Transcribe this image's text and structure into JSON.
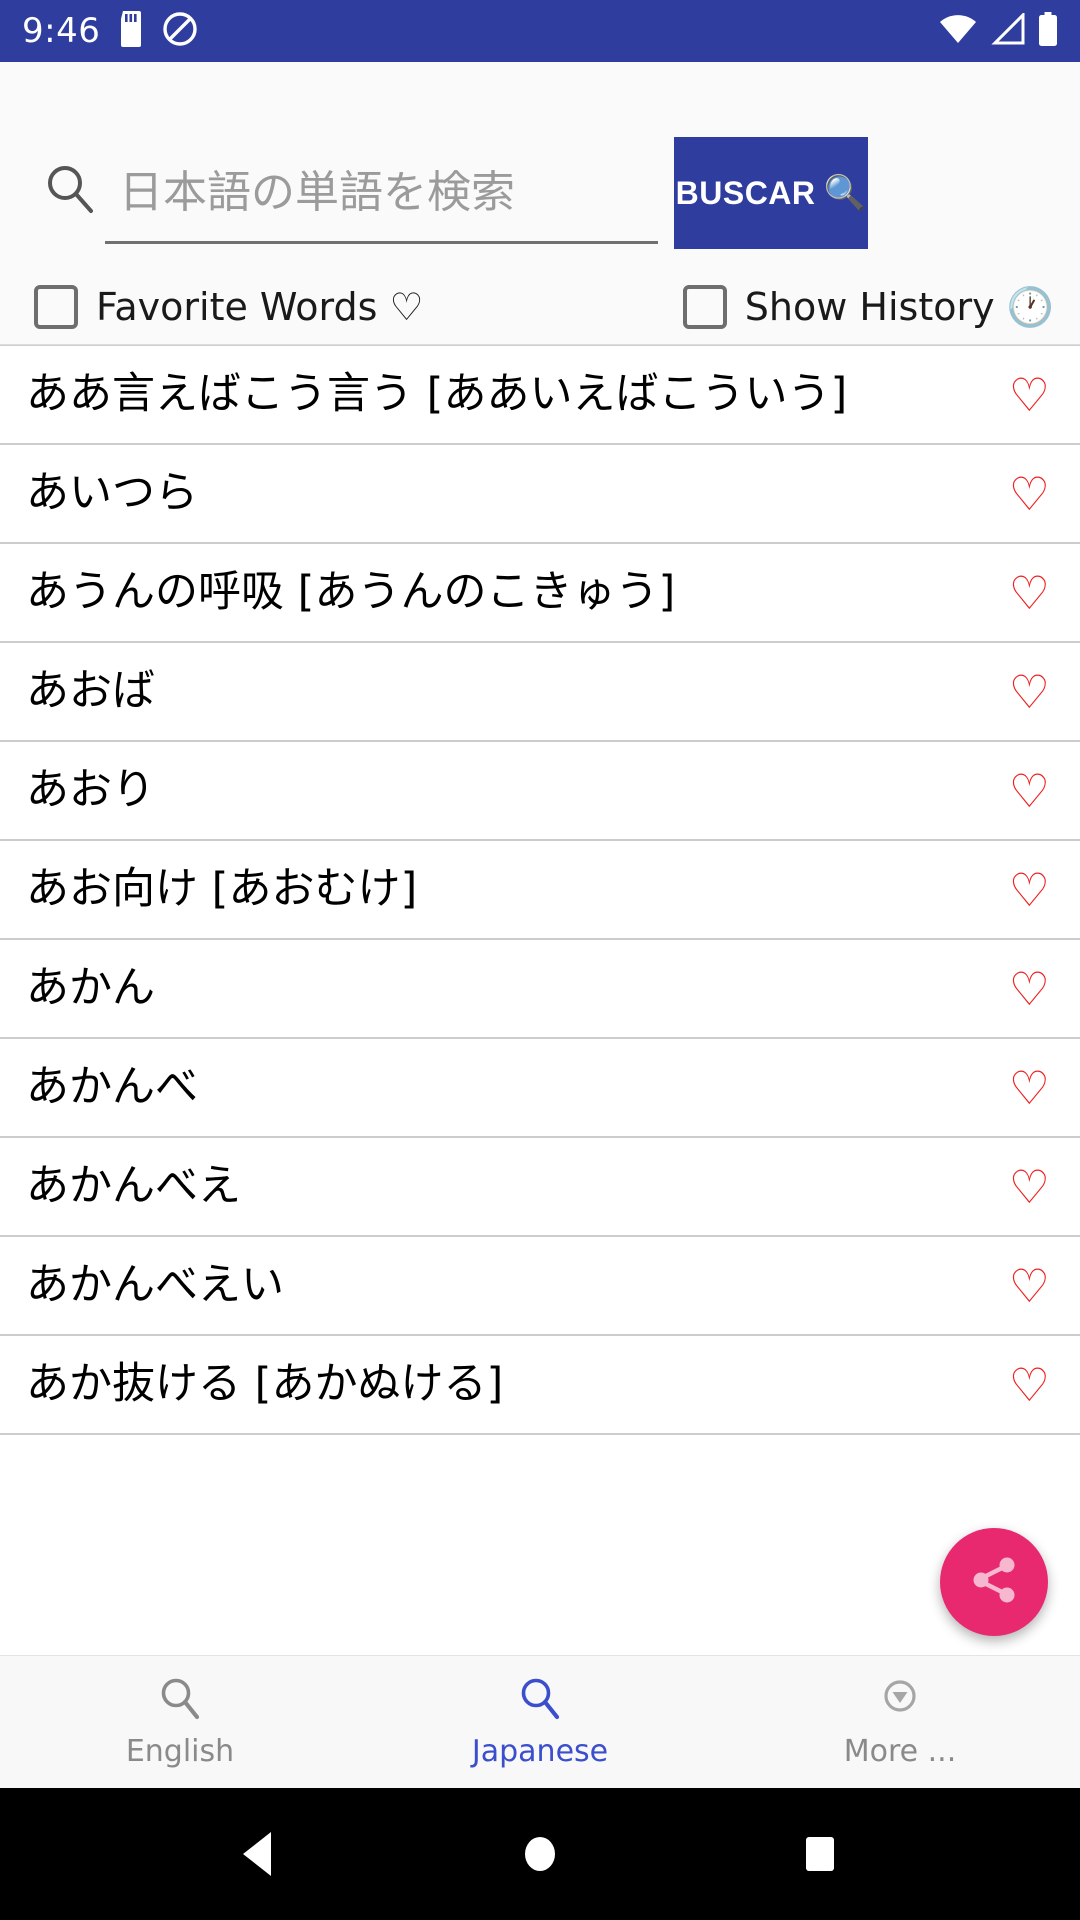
{
  "status_bar": {
    "time": "9:46",
    "left_icons": [
      "sd-card-icon",
      "do-not-disturb-icon"
    ],
    "right_icons": [
      "wifi-icon",
      "cellular-signal-icon",
      "battery-icon"
    ],
    "background_color": "#2f3e9e"
  },
  "search": {
    "placeholder": "日本語の単語を検索",
    "value": "",
    "icon": "search-icon",
    "button_label": "BUSCAR",
    "button_emoji": "🔍",
    "button_color": "#2f3e9e"
  },
  "filters": [
    {
      "label": "Favorite Words ♡",
      "checked": false,
      "name": "favorite-words"
    },
    {
      "label": "Show History 🕐",
      "checked": false,
      "name": "show-history"
    }
  ],
  "word_list": {
    "favorite_icon": "heart-outline-icon",
    "favorite_color": "#ee2020",
    "items": [
      {
        "word": "ああ言えばこう言う [ああいえばこういう]"
      },
      {
        "word": "あいつら"
      },
      {
        "word": "あうんの呼吸 [あうんのこきゅう]"
      },
      {
        "word": "あおば"
      },
      {
        "word": "あおり"
      },
      {
        "word": "あお向け [あおむけ]"
      },
      {
        "word": "あかん"
      },
      {
        "word": "あかんべ"
      },
      {
        "word": "あかんべえ"
      },
      {
        "word": "あかんべえい"
      },
      {
        "word": "あか抜ける [あかぬける]"
      }
    ]
  },
  "fab": {
    "icon": "share-icon",
    "color": "#e8296f"
  },
  "bottom_nav": {
    "active_color": "#3b4ecc",
    "inactive_color": "#8a8a8a",
    "items": [
      {
        "label": "English",
        "icon": "search-icon",
        "active": false
      },
      {
        "label": "Japanese",
        "icon": "search-icon",
        "active": true
      },
      {
        "label": "More ...",
        "icon": "chevron-down-circle-icon",
        "active": false
      }
    ]
  },
  "android_nav": {
    "buttons": [
      "back-icon",
      "home-icon",
      "recents-icon"
    ]
  }
}
